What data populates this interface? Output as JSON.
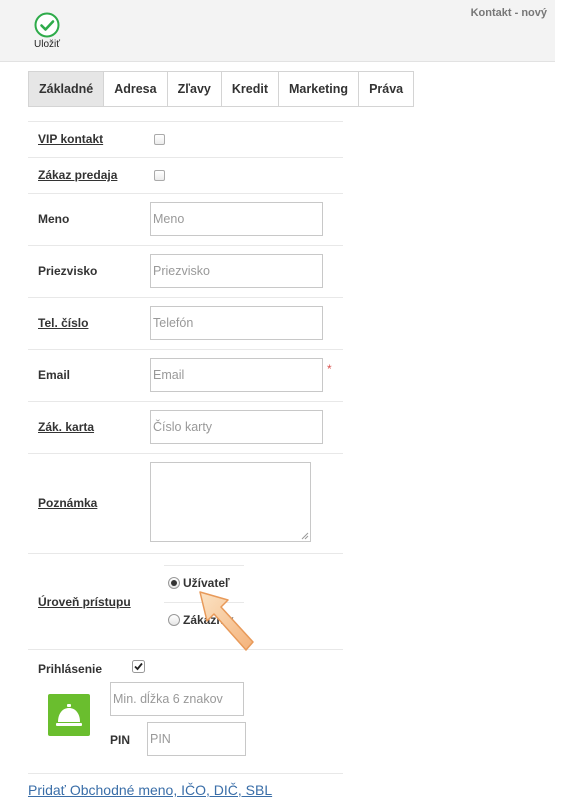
{
  "window": {
    "title": "Kontakt - nový"
  },
  "toolbar": {
    "save_label": "Uložiť",
    "save_icon": "check-circle-icon",
    "accent": "#2eab4a"
  },
  "tabs": [
    {
      "label": "Základné",
      "active": true
    },
    {
      "label": "Adresa"
    },
    {
      "label": "Zľavy"
    },
    {
      "label": "Kredit"
    },
    {
      "label": "Marketing"
    },
    {
      "label": "Práva"
    }
  ],
  "form": {
    "vip": {
      "label": "VIP kontakt",
      "checked": false
    },
    "sale_ban": {
      "label": "Zákaz predaja",
      "checked": false
    },
    "name": {
      "label": "Meno",
      "placeholder": "Meno",
      "value": ""
    },
    "surname": {
      "label": "Priezvisko",
      "placeholder": "Priezvisko",
      "value": ""
    },
    "phone": {
      "label": "Tel. číslo",
      "placeholder": "Telefón",
      "value": ""
    },
    "email": {
      "label": "Email",
      "placeholder": "Email",
      "value": "",
      "required_mark": "*"
    },
    "card": {
      "label": "Zák. karta",
      "placeholder": "Číslo karty",
      "value": ""
    },
    "note": {
      "label": "Poznámka",
      "value": ""
    },
    "access": {
      "label": "Úroveň prístupu",
      "options": [
        {
          "label": "Užívateľ",
          "checked": true
        },
        {
          "label": "Zákazník",
          "checked": false
        }
      ]
    },
    "login": {
      "label": "Prihlásenie",
      "checked": true,
      "icon": "bell-icon",
      "icon_color": "#6abe2e",
      "password_placeholder": "Min. dĺžka 6 znakov",
      "pin_label": "PIN",
      "pin_placeholder": "PIN"
    }
  },
  "links": {
    "add_business": "Pridať Obchodné meno, IČO, DIČ, SBL"
  }
}
